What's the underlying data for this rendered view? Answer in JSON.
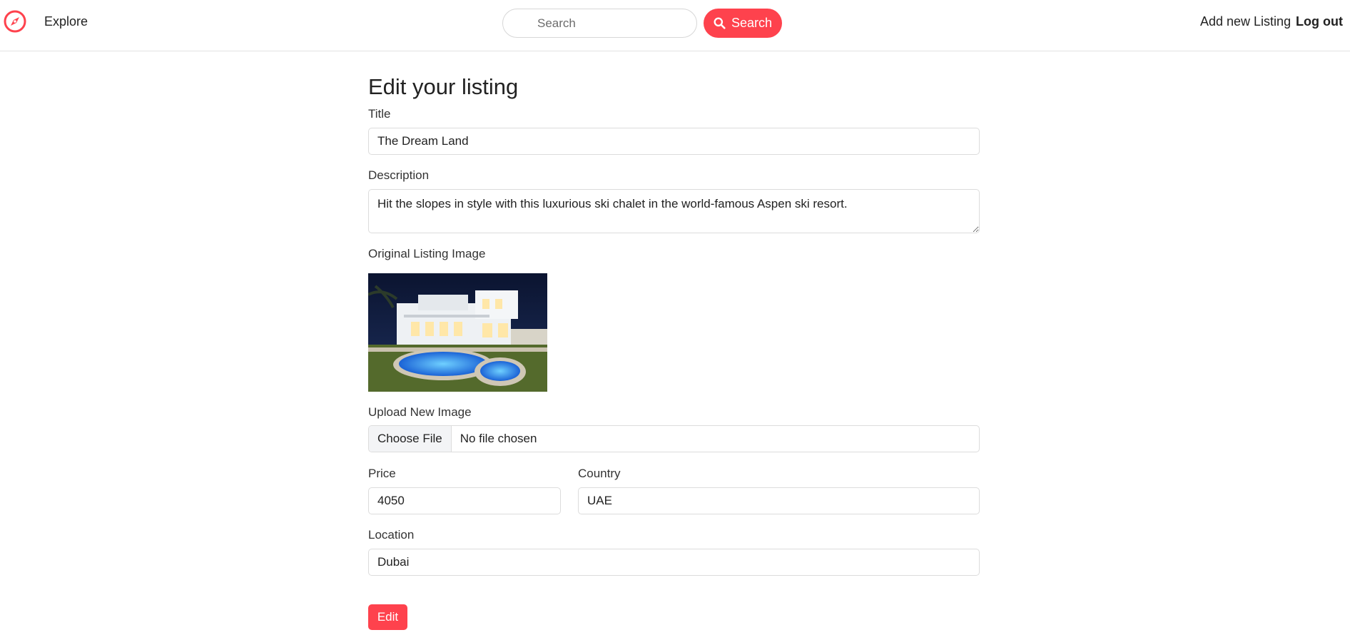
{
  "nav": {
    "explore_label": "Explore",
    "search_placeholder": "Search",
    "search_button_label": "Search",
    "add_listing_label": "Add new Listing",
    "logout_label": "Log out"
  },
  "form": {
    "heading": "Edit your listing",
    "title_label": "Title",
    "title_value": "The Dream Land",
    "description_label": "Description",
    "description_value": "Hit the slopes in style with this luxurious ski chalet in the world-famous Aspen ski resort.",
    "original_image_label": "Original Listing Image",
    "upload_label": "Upload New Image",
    "choose_file_label": "Choose File",
    "no_file_text": "No file chosen",
    "price_label": "Price",
    "price_value": "4050",
    "country_label": "Country",
    "country_value": "UAE",
    "location_label": "Location",
    "location_value": "Dubai",
    "submit_label": "Edit"
  },
  "colors": {
    "accent": "#fe424d"
  },
  "icons": {
    "brand": "compass-icon",
    "search": "search-icon"
  }
}
